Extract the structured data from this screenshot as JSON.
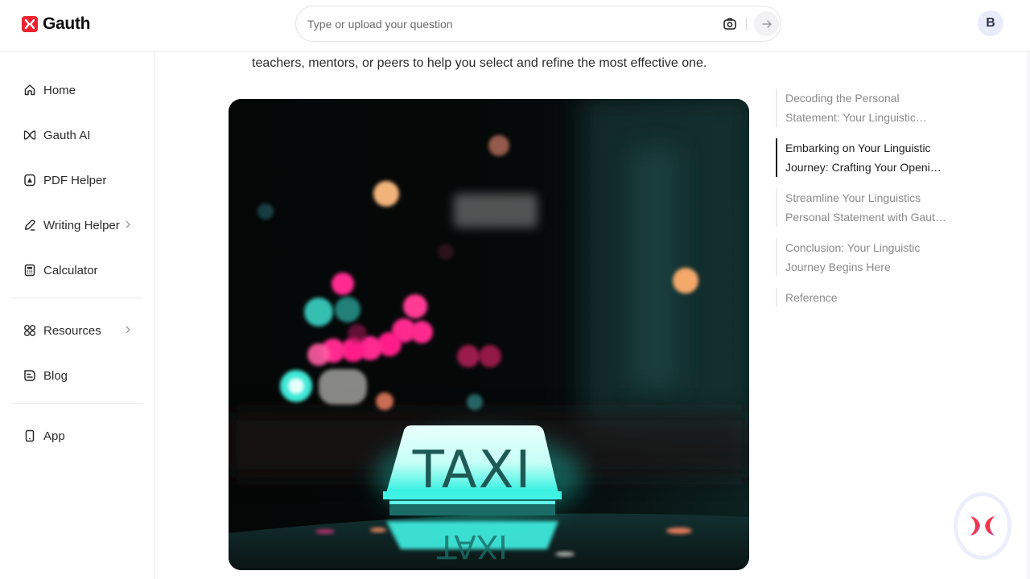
{
  "header": {
    "brand": "Gauth",
    "search_placeholder": "Type or upload your question",
    "camera_icon": "camera-icon",
    "send_icon": "arrow-right-icon",
    "avatar_initial": "B",
    "brand_color": "#f0212f"
  },
  "sidebar": {
    "items": [
      {
        "label": "Home",
        "icon": "home-icon"
      },
      {
        "label": "Gauth AI",
        "icon": "gauth-ai-icon"
      },
      {
        "label": "PDF Helper",
        "icon": "pdf-icon"
      },
      {
        "label": "Writing Helper",
        "icon": "pen-icon",
        "has_submenu": true
      },
      {
        "label": "Calculator",
        "icon": "calculator-icon"
      },
      {
        "label": "Resources",
        "icon": "grid-icon",
        "has_submenu": true
      },
      {
        "label": "Blog",
        "icon": "blog-icon"
      },
      {
        "label": "App",
        "icon": "phone-icon"
      }
    ]
  },
  "main": {
    "intro_text": "teachers, mentors, or peers to help you select and refine the most effective one.",
    "image": {
      "description": "Blurred night street with glowing cyan taxi roof sign",
      "sign_text": "TAXI",
      "sign_color": "#3ff2e4"
    }
  },
  "toc": {
    "items": [
      {
        "label": "Decoding the Personal Statement: Your Linguistic…",
        "line1": "Decoding the Personal",
        "line2": "Statement: Your Linguistic…",
        "active": false
      },
      {
        "label": "Embarking on Your Linguistic Journey: Crafting Your Openin…",
        "line1": "Embarking on Your Linguistic",
        "line2": "Journey: Crafting Your Openin…",
        "active": true
      },
      {
        "label": "Streamline Your Linguistics Personal Statement with Gaut…",
        "line1": "Streamline Your Linguistics",
        "line2": "Personal Statement with Gaut…",
        "active": false
      },
      {
        "label": "Conclusion: Your Linguistic Journey Begins Here",
        "line1": "Conclusion: Your Linguistic",
        "line2": "Journey Begins Here",
        "active": false
      },
      {
        "label": "Reference",
        "line1": "Reference",
        "line2": "",
        "active": false
      }
    ]
  },
  "fab": {
    "icon": "gauth-logo-icon"
  }
}
